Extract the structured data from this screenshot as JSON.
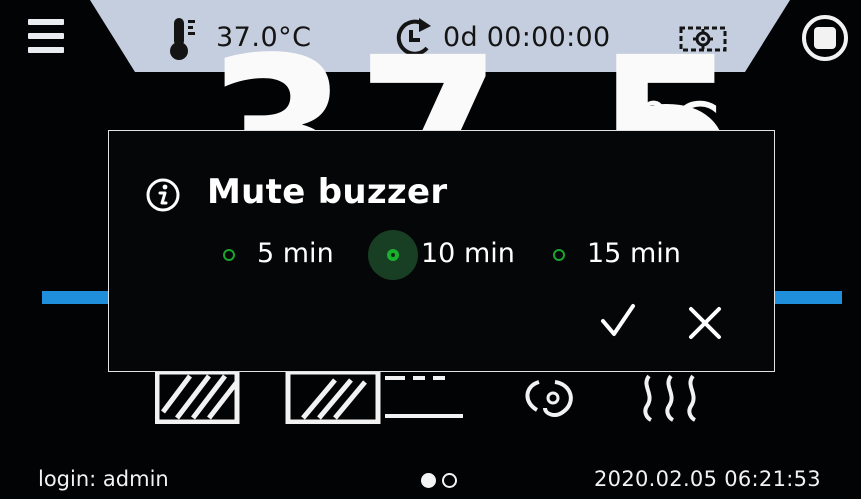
{
  "header": {
    "temperature": "37.0°C",
    "timer": "0d 00:00:00",
    "colors": {
      "bar": "#c5cedf",
      "text": "#141414"
    }
  },
  "background": {
    "big_value": "37.5",
    "big_unit": "°C",
    "progress_color": "#1f8fdc"
  },
  "dialog": {
    "title": "Mute buzzer",
    "options": [
      {
        "label": "5 min",
        "selected": false
      },
      {
        "label": "10 min",
        "selected": true
      },
      {
        "label": "15 min",
        "selected": false
      }
    ],
    "accent": "#19b02e",
    "icons": [
      "info-icon",
      "check-icon",
      "close-icon"
    ]
  },
  "footer": {
    "login": "login: admin",
    "datetime": "2020.02.05 06:21:53",
    "pages": 2,
    "current_page": 1
  }
}
